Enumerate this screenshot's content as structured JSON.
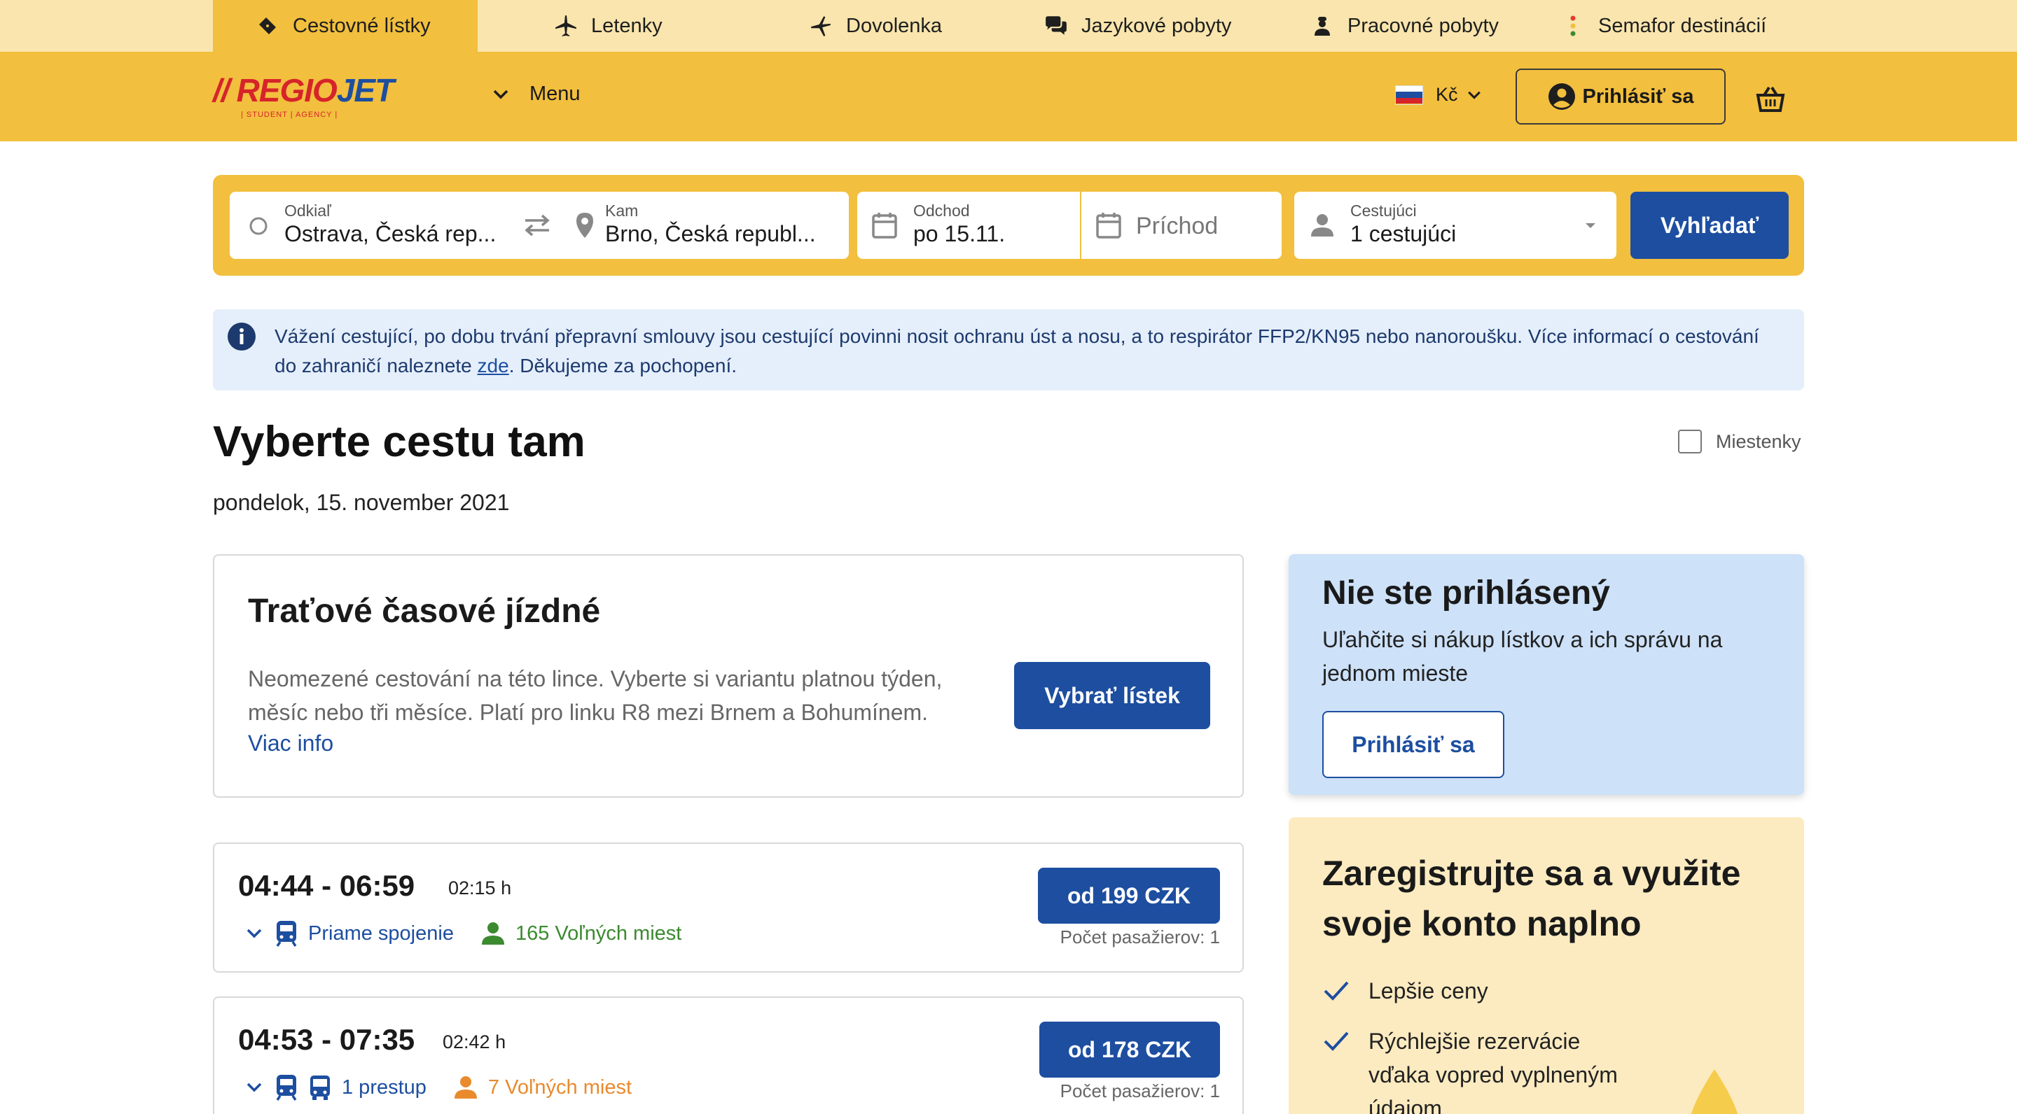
{
  "topnav": {
    "items": [
      {
        "label": "Cestovné lístky",
        "icon": "ticket-icon",
        "active": true
      },
      {
        "label": "Letenky",
        "icon": "airplane-icon"
      },
      {
        "label": "Dovolenka",
        "icon": "palm-plane-icon"
      },
      {
        "label": "Jazykové pobyty",
        "icon": "chat-bubbles-icon"
      },
      {
        "label": "Pracovné pobyty",
        "icon": "worker-icon"
      },
      {
        "label": "Semafor destinácií",
        "icon": "traffic-light-icon"
      }
    ]
  },
  "header": {
    "logo_main": "REGIO",
    "logo_accent": "JET",
    "logo_sub": "| STUDENT | AGENCY |",
    "menu_label": "Menu",
    "currency": "Kč",
    "login_label": "Prihlásiť sa",
    "colors": {
      "bar": "#f2bf3e",
      "topnav": "#f9e5ad",
      "brand_red": "#d6242a",
      "brand_blue": "#1d4ea0"
    }
  },
  "search": {
    "from_label": "Odkiaľ",
    "from_value": "Ostrava, Česká rep...",
    "to_label": "Kam",
    "to_value": "Brno, Česká republ...",
    "depart_label": "Odchod",
    "depart_value": "po 15.11.",
    "return_placeholder": "Príchod",
    "passengers_label": "Cestujúci",
    "passengers_value": "1 cestujúci",
    "search_button": "Vyhľadať"
  },
  "banner": {
    "text_before": "Vážení cestující, po dobu trvání přepravní smlouvy jsou cestující povinni nosit ochranu úst a nosu, a to respirátor FFP2/KN95 nebo nanoroušku. Více informací o cestování do zahraničí naleznete ",
    "link": "zde",
    "text_after": ". Děkujeme za pochopení."
  },
  "main": {
    "title": "Vyberte cestu tam",
    "date": "pondelok, 15. november 2021",
    "seats_checkbox": "Miestenky"
  },
  "pass_card": {
    "title": "Traťové časové jízdné",
    "description": "Neomezené cestování na této lince. Vyberte si variantu platnou týden, měsíc nebo tři měsíce. Platí pro linku R8 mezi Brnem a Bohumínem.",
    "more": "Viac info",
    "button": "Vybrať lístek"
  },
  "connections": [
    {
      "times": "04:44 - 06:59",
      "duration": "02:15 h",
      "type": "Priame spojenie",
      "free": "165 Voľných miest",
      "price": "od 199 CZK",
      "pax": "Počet pasažierov: 1",
      "availability": "high"
    },
    {
      "times": "04:53 - 07:35",
      "duration": "02:42 h",
      "type": "1 prestup",
      "free": "7 Voľných miest",
      "price": "od 178 CZK",
      "pax": "Počet pasažierov: 1",
      "availability": "low"
    }
  ],
  "side_login": {
    "title": "Nie ste prihlásený",
    "description": "Uľahčite si nákup lístkov a ich správu na jednom mieste",
    "button": "Prihlásiť sa"
  },
  "side_register": {
    "title": "Zaregistrujte sa a využite svoje konto naplno",
    "benefits": [
      "Lepšie ceny",
      "Rýchlejšie rezervácie vďaka vopred vyplneným údajom"
    ]
  }
}
